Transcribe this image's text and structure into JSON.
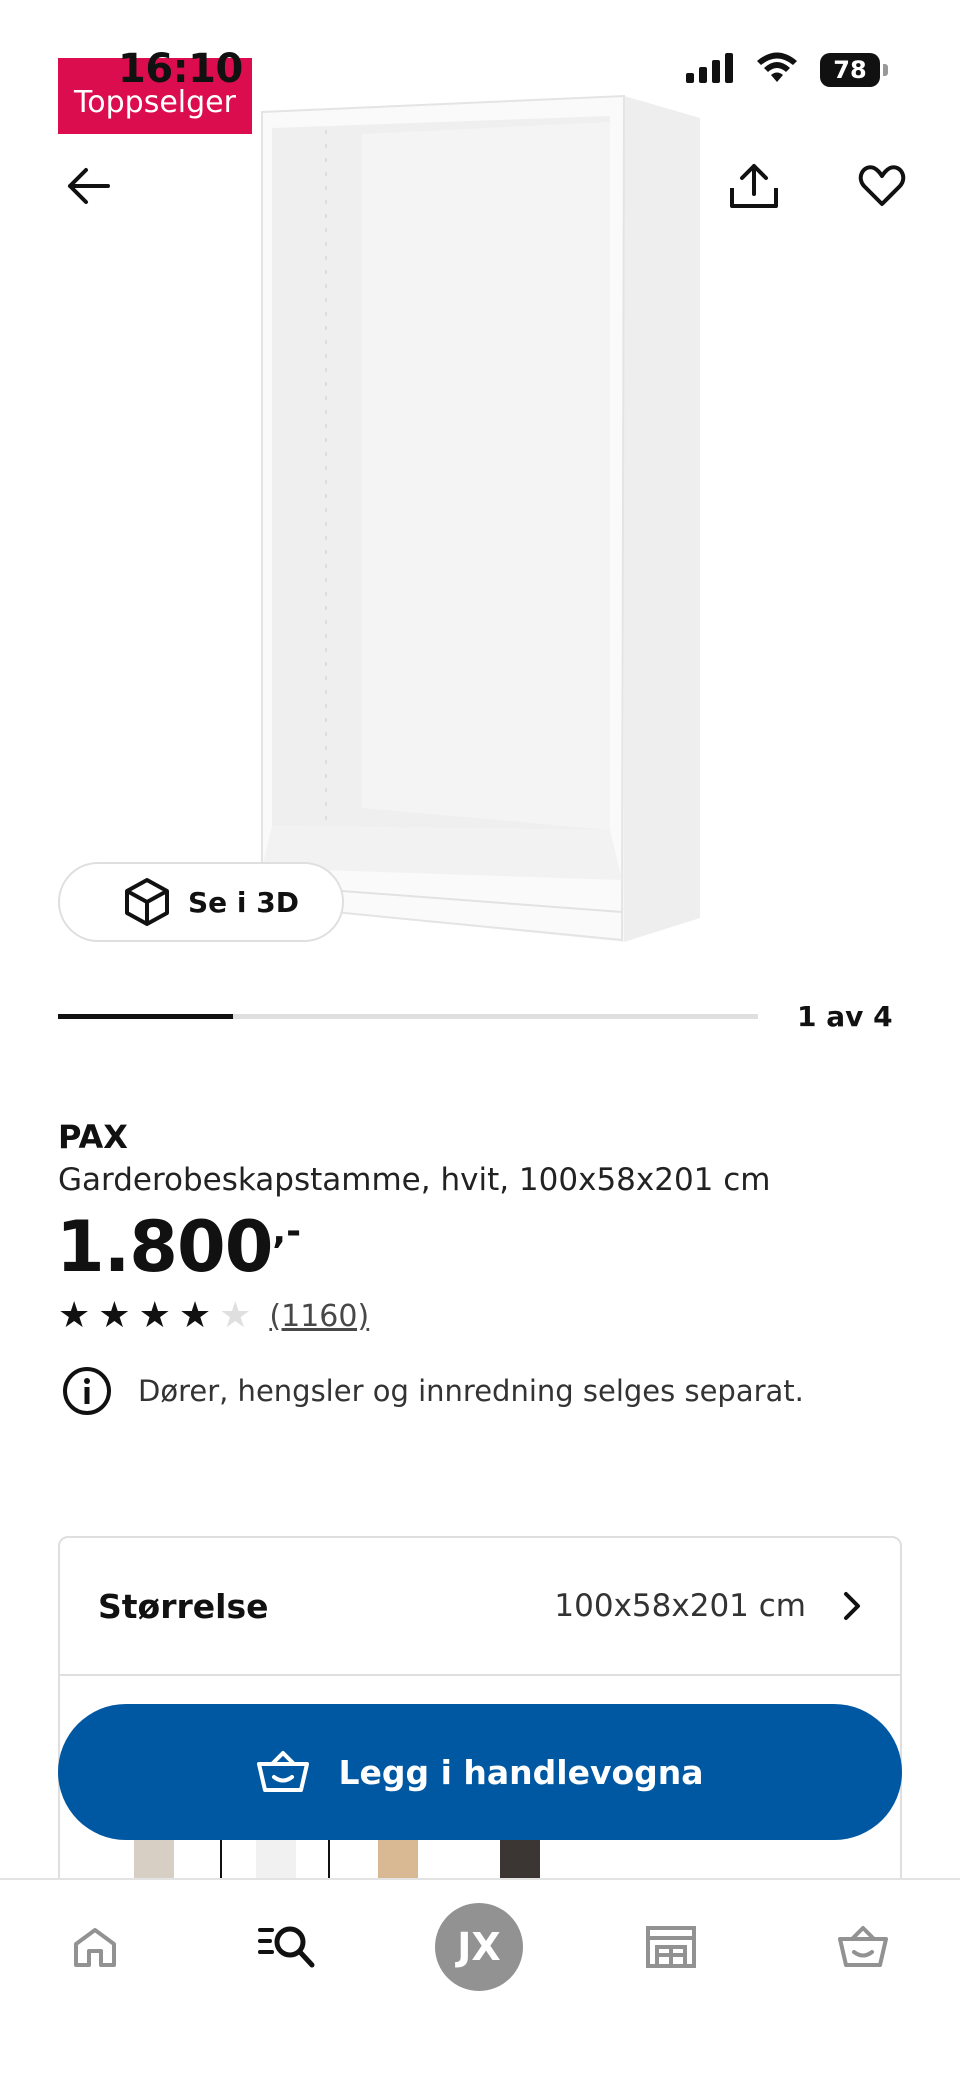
{
  "status_bar": {
    "time": "16:10",
    "battery": "78"
  },
  "product_image": {
    "badge": "Toppselger",
    "view_3d_label": "Se i 3D",
    "image_position": "1 av 4",
    "progress": 0.25
  },
  "product": {
    "name": "PAX",
    "description": "Garderobeskapstamme, hvit, 100x58x201 cm",
    "price": "1.800",
    "price_suffix": ",-",
    "rating": 4,
    "rating_max": 5,
    "review_count": "(1160)",
    "notice": "Dører, hengsler og innredning selges separat."
  },
  "options": {
    "size_label": "Størrelse",
    "size_value": "100x58x201 cm"
  },
  "cart_button": {
    "label": "Legg i handlevogna"
  },
  "bottom_nav": {
    "avatar_initials": "JX"
  },
  "colors": {
    "badge": "#dc0d4e",
    "primary": "#0058a3"
  }
}
